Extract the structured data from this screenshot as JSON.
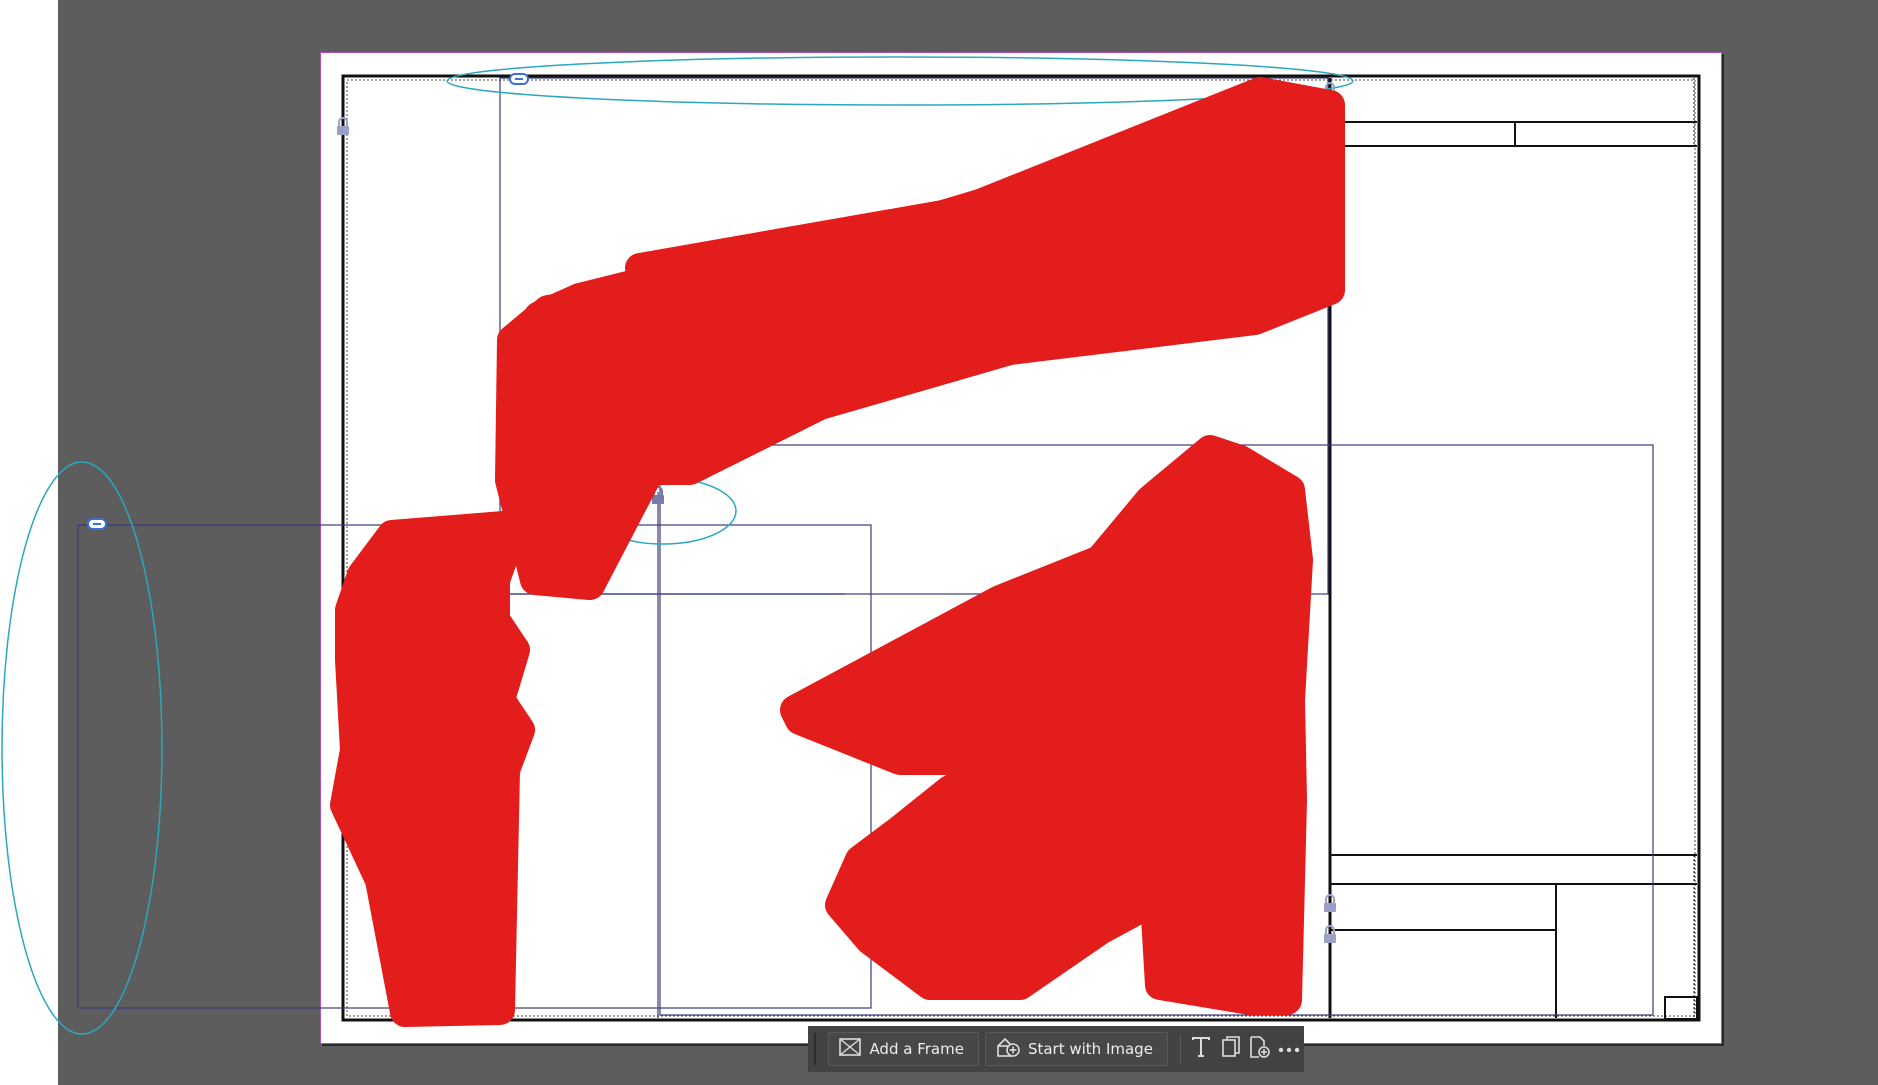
{
  "quick_actions": {
    "add_frame_label": "Add a Frame",
    "start_image_label": "Start with Image",
    "icons": [
      "frame-icon",
      "image-add-icon",
      "text-icon",
      "pages-icon",
      "add-page-icon",
      "more-icon"
    ]
  },
  "colors": {
    "pasteboard": "#5d5d5d",
    "page": "#ffffff",
    "frame_stroke": "#3b3b7a",
    "highlight_ellipse": "#2aa8c0",
    "redaction": "#e31c1c",
    "toolbar": "#424242"
  }
}
